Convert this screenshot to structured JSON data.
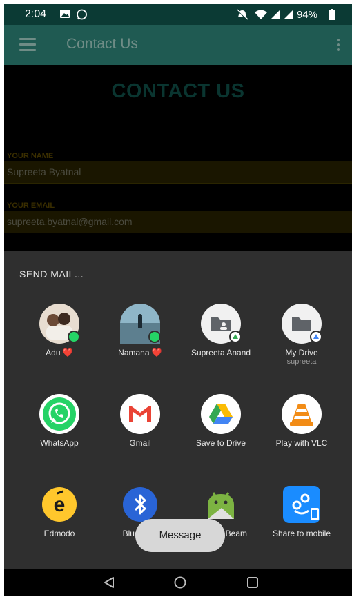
{
  "status_bar": {
    "time": "2:04",
    "battery": "94%",
    "icons": [
      "image-icon",
      "whatsapp-status-icon",
      "mute-icon",
      "wifi-icon",
      "signal-icon",
      "signal-icon",
      "battery-icon"
    ]
  },
  "app_bar": {
    "title": "Contact Us",
    "icons": [
      "hamburger-menu-icon",
      "overflow-menu-icon"
    ]
  },
  "page": {
    "heading": "CONTACT US",
    "name_label": "YOUR NAME",
    "name_value": "Supreeta Byatnal",
    "email_label": "YOUR EMAIL",
    "email_value": "supreeta.byatnal@gmail.com"
  },
  "share_sheet": {
    "title": "SEND MAIL...",
    "targets": [
      {
        "label": "Adu ❤️",
        "sub": "",
        "icon": "contact-photo-icon"
      },
      {
        "label": "Namana ❤️",
        "sub": "",
        "icon": "contact-photo-icon"
      },
      {
        "label": "Supreeta Anand",
        "sub": "",
        "icon": "shared-folder-icon"
      },
      {
        "label": "My Drive",
        "sub": "supreeta",
        "icon": "folder-icon"
      },
      {
        "label": "WhatsApp",
        "sub": "",
        "icon": "whatsapp-icon"
      },
      {
        "label": "Gmail",
        "sub": "",
        "icon": "gmail-icon"
      },
      {
        "label": "Save to Drive",
        "sub": "",
        "icon": "google-drive-icon"
      },
      {
        "label": "Play with VLC",
        "sub": "",
        "icon": "vlc-icon"
      },
      {
        "label": "Edmodo",
        "sub": "",
        "icon": "edmodo-icon"
      },
      {
        "label": "Bluetooth",
        "sub": "",
        "icon": "bluetooth-icon"
      },
      {
        "label": "Android Beam",
        "sub": "",
        "icon": "android-beam-icon"
      },
      {
        "label": "Share to mobile",
        "sub": "",
        "icon": "share-to-mobile-icon"
      }
    ]
  },
  "toast": {
    "text": "Message"
  },
  "nav_bar": {
    "icons": [
      "back-icon",
      "home-icon",
      "recents-icon"
    ]
  },
  "colors": {
    "app_bar": "#1f5a52",
    "status_bar": "#0b3a34",
    "sheet": "#2f2f2f"
  }
}
